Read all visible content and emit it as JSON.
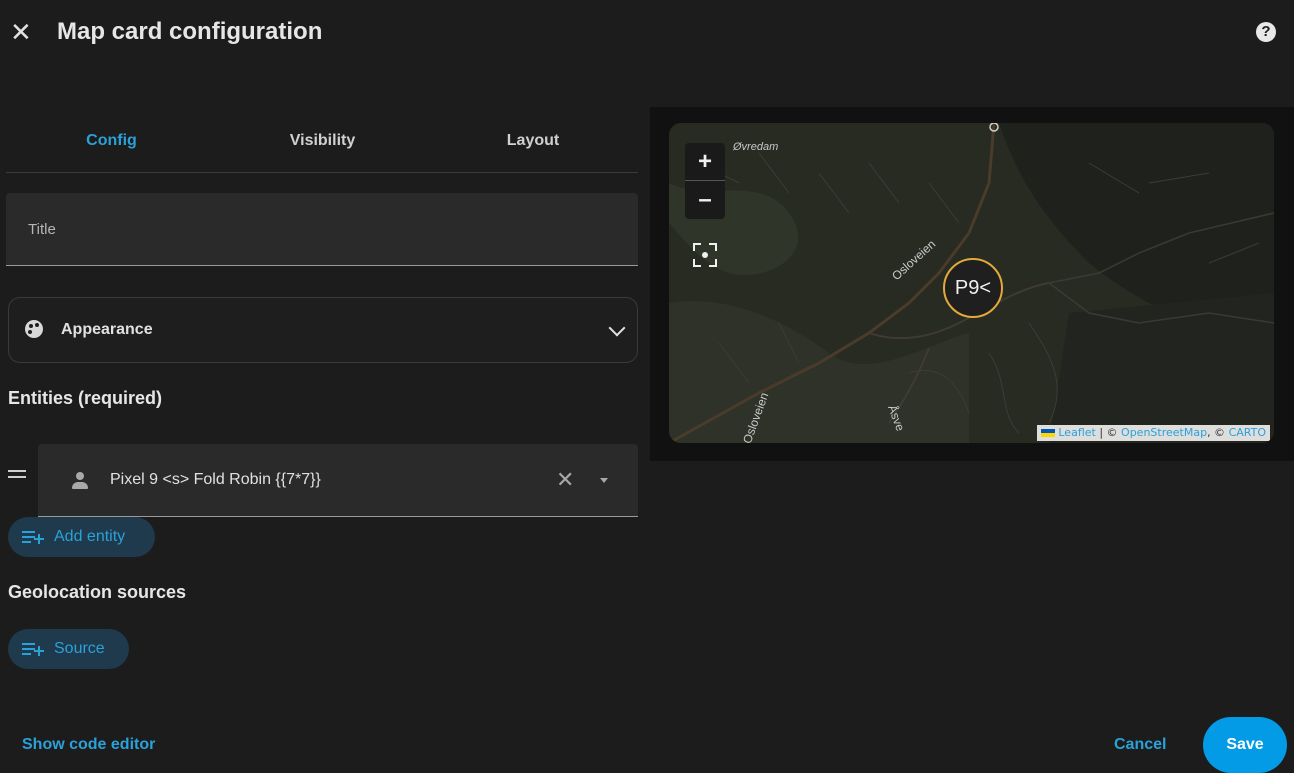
{
  "dialog": {
    "title": "Map card configuration",
    "close_icon": "close-icon",
    "help_icon": "help-icon",
    "help_glyph": "?"
  },
  "tabs": [
    {
      "label": "Config",
      "active": true
    },
    {
      "label": "Visibility",
      "active": false
    },
    {
      "label": "Layout",
      "active": false
    }
  ],
  "fields": {
    "title_label": "Title",
    "title_value": ""
  },
  "appearance": {
    "label": "Appearance",
    "icon": "palette-icon",
    "expanded": false
  },
  "entities": {
    "heading": "Entities (required)",
    "items": [
      {
        "value": "Pixel 9 <s> Fold Robin {{7*7}}",
        "icon": "person-icon"
      }
    ],
    "clear_glyph": "✕",
    "add_label": "Add entity"
  },
  "geolocation": {
    "heading": "Geolocation sources",
    "add_label": "Source"
  },
  "footer": {
    "code_editor_label": "Show code editor",
    "cancel_label": "Cancel",
    "save_label": "Save"
  },
  "map": {
    "zoom_in": "+",
    "zoom_out": "–",
    "marker_label": "P9<",
    "place_labels": [
      "Øvredam",
      "Osloveien",
      "Osloveien",
      "Åsve"
    ],
    "attribution": {
      "leaflet": "Leaflet",
      "sep1": " | © ",
      "osm": "OpenStreetMap",
      "sep2": ", © ",
      "carto": "CARTO"
    },
    "colors": {
      "marker_border": "#e3a93a",
      "accent": "#2aa1d9",
      "save_bg": "#039be5"
    }
  }
}
